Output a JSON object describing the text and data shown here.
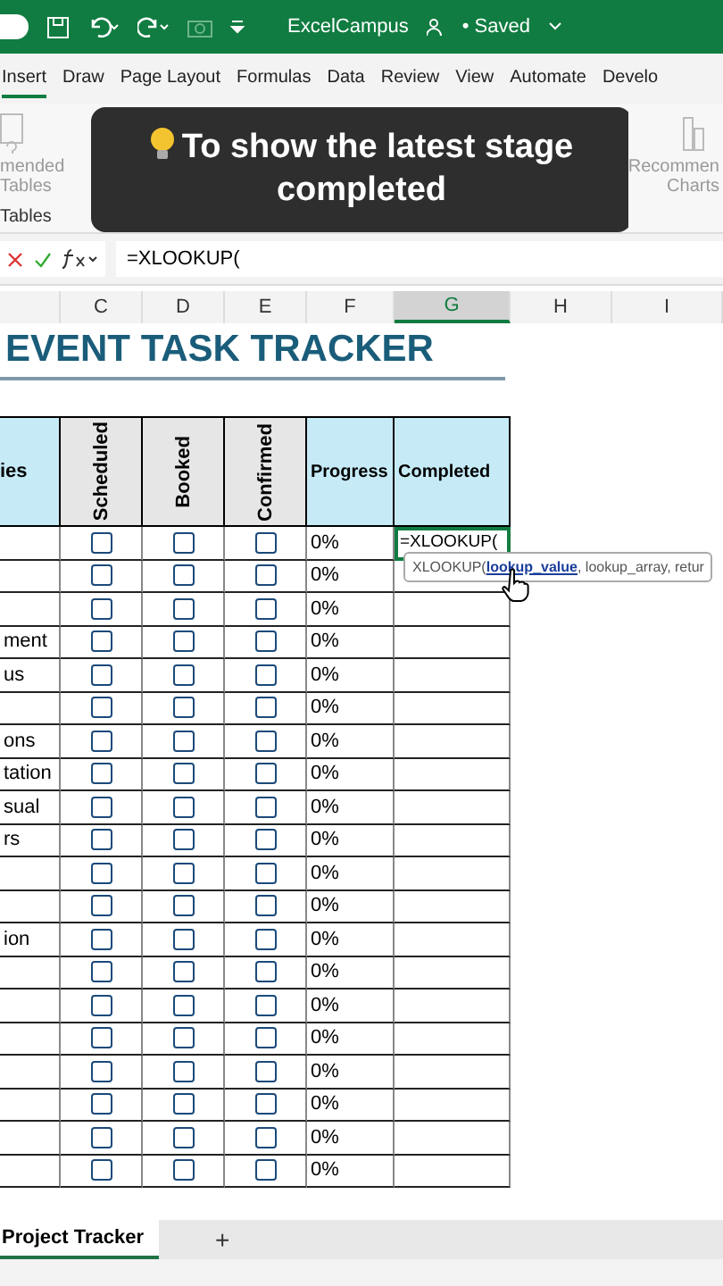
{
  "title_bar": {
    "workbook": "ExcelCampus",
    "status": "• Saved"
  },
  "tabs": [
    {
      "label": "Insert",
      "selected": true
    },
    {
      "label": "Draw",
      "selected": false
    },
    {
      "label": "Page Layout",
      "selected": false
    },
    {
      "label": "Formulas",
      "selected": false
    },
    {
      "label": "Data",
      "selected": false
    },
    {
      "label": "Review",
      "selected": false
    },
    {
      "label": "View",
      "selected": false
    },
    {
      "label": "Automate",
      "selected": false
    },
    {
      "label": "Develo",
      "selected": false
    }
  ],
  "ribbon": {
    "left_item": "mended\nTables",
    "left_group": "Tables",
    "right_item": "Recommen\nCharts"
  },
  "caption": "To show the latest stage completed",
  "formula_bar": {
    "value": "=XLOOKUP("
  },
  "columns": [
    {
      "label": "C",
      "selected": false
    },
    {
      "label": "D",
      "selected": false
    },
    {
      "label": "E",
      "selected": false
    },
    {
      "label": "F",
      "selected": false
    },
    {
      "label": "G",
      "selected": true
    },
    {
      "label": "H",
      "selected": false
    },
    {
      "label": "I",
      "selected": false
    }
  ],
  "sheet_title": "EVENT TASK TRACKER",
  "table": {
    "headers": [
      "ies",
      "Scheduled",
      "Booked",
      "Confirmed",
      "Progress",
      "Completed"
    ],
    "rows": [
      {
        "scheduled": false,
        "booked": false,
        "confirmed": false,
        "progress": "0%",
        "completed": "=XLOOKUP(",
        "active": true
      },
      {
        "scheduled": false,
        "booked": false,
        "confirmed": false,
        "progress": "0%",
        "active": false
      },
      {
        "scheduled": false,
        "booked": false,
        "confirmed": false,
        "progress": "0%",
        "active": false
      },
      {
        "task": "ment",
        "scheduled": false,
        "booked": false,
        "confirmed": false,
        "progress": "0%",
        "active": false
      },
      {
        "task": "us",
        "scheduled": false,
        "booked": false,
        "confirmed": false,
        "progress": "0%",
        "active": false
      },
      {
        "scheduled": false,
        "booked": false,
        "confirmed": false,
        "progress": "0%",
        "active": false
      },
      {
        "task": "ons",
        "scheduled": false,
        "booked": false,
        "confirmed": false,
        "progress": "0%",
        "active": false
      },
      {
        "task": "tation",
        "scheduled": false,
        "booked": false,
        "confirmed": false,
        "progress": "0%",
        "active": false
      },
      {
        "task": "sual",
        "scheduled": false,
        "booked": false,
        "confirmed": false,
        "progress": "0%",
        "active": false
      },
      {
        "task": "rs",
        "scheduled": false,
        "booked": false,
        "confirmed": false,
        "progress": "0%",
        "active": false
      },
      {
        "scheduled": false,
        "booked": false,
        "confirmed": false,
        "progress": "0%",
        "active": false
      },
      {
        "scheduled": false,
        "booked": false,
        "confirmed": false,
        "progress": "0%",
        "active": false
      },
      {
        "task": "ion",
        "scheduled": false,
        "booked": false,
        "confirmed": false,
        "progress": "0%",
        "active": false
      },
      {
        "scheduled": false,
        "booked": false,
        "confirmed": false,
        "progress": "0%",
        "active": false
      },
      {
        "scheduled": false,
        "booked": false,
        "confirmed": false,
        "progress": "0%",
        "active": false
      },
      {
        "scheduled": false,
        "booked": false,
        "confirmed": false,
        "progress": "0%",
        "active": false
      },
      {
        "scheduled": false,
        "booked": false,
        "confirmed": false,
        "progress": "0%",
        "active": false
      },
      {
        "scheduled": false,
        "booked": false,
        "confirmed": false,
        "progress": "0%",
        "active": false
      },
      {
        "scheduled": false,
        "booked": false,
        "confirmed": false,
        "progress": "0%",
        "active": false
      },
      {
        "scheduled": false,
        "booked": false,
        "confirmed": false,
        "progress": "0%",
        "active": false
      }
    ]
  },
  "tooltip": "XLOOKUP(**lookup_value**, lookup_array, retur",
  "sheet_tabs": [
    {
      "label": "Project Tracker",
      "selected": true
    }
  ],
  "add_sheet": "+"
}
